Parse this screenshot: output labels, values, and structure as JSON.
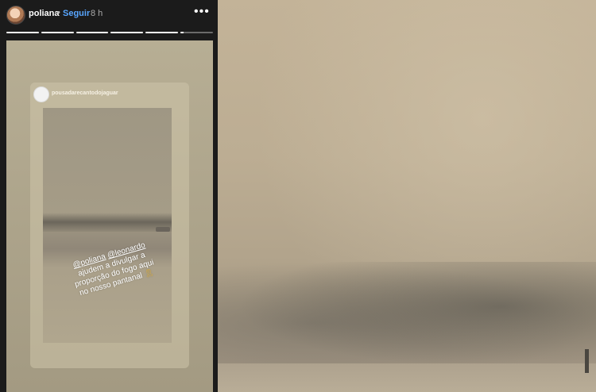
{
  "story": {
    "username": "poliana",
    "separator": "•",
    "follow_label": "Seguir",
    "time_ago": "8 h",
    "more_icon_glyph": "•••",
    "progress_segments": [
      {
        "filled": 1
      },
      {
        "filled": 1
      },
      {
        "filled": 1
      },
      {
        "filled": 1
      },
      {
        "filled": 1
      },
      {
        "filled": 0.1
      }
    ],
    "repost": {
      "account_name": "pousadarecantodojaguar",
      "caption": {
        "mention_1": "@poliana",
        "mention_2": "@leonardo",
        "line_2": "ajudem a divulgar a",
        "line_3": "proporção do fogo aqui",
        "line_4": "no nosso pantanal",
        "emoji": "🎗"
      }
    }
  },
  "icons": {
    "avatar": "profile-photo",
    "more": "three-dots-icon",
    "repost_avatar": "account-logo"
  }
}
